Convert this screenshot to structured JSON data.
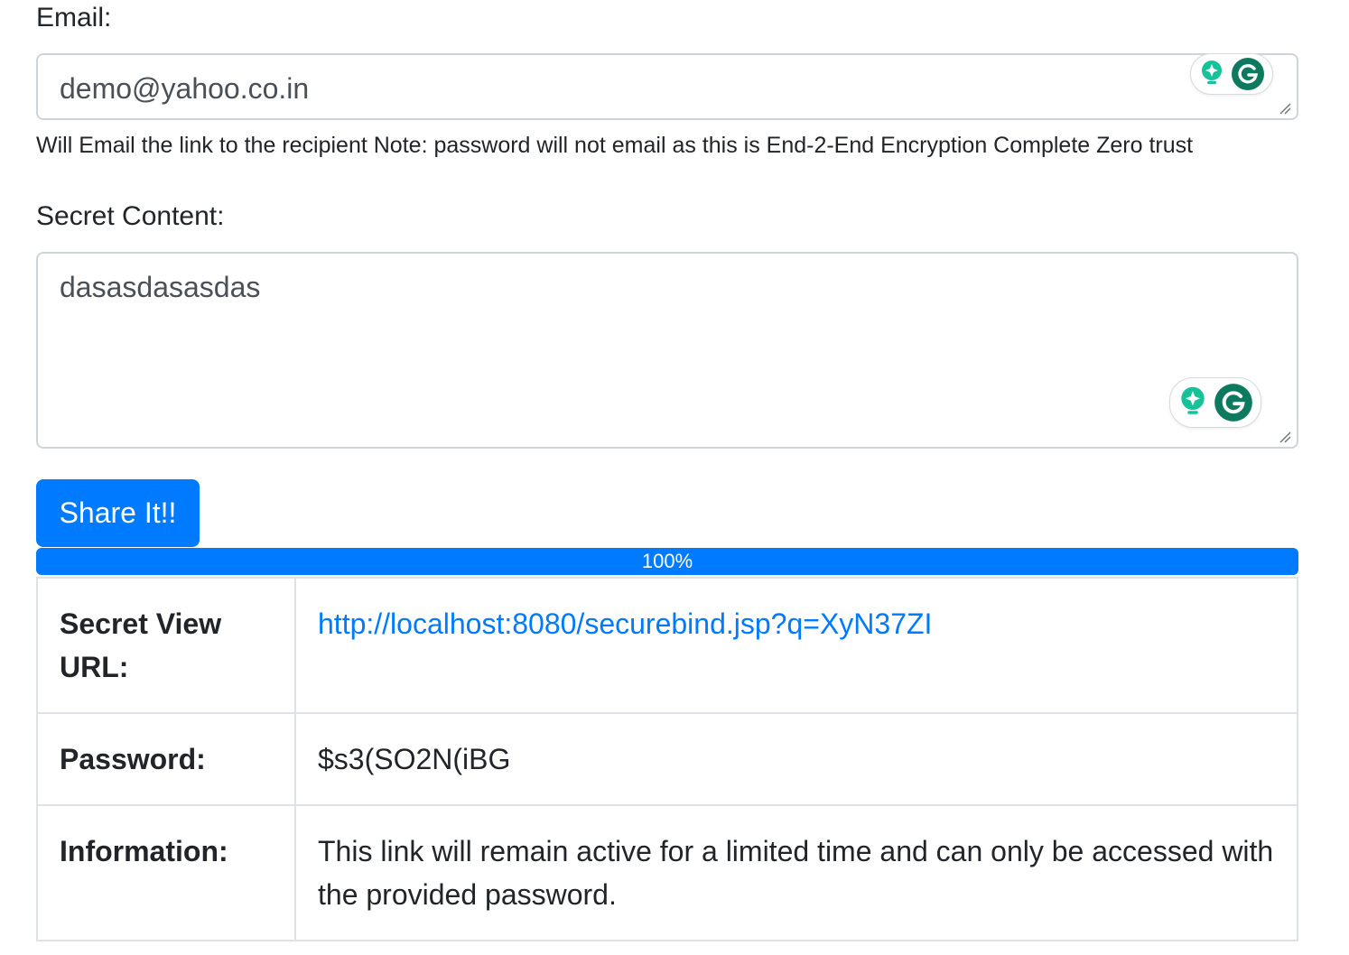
{
  "form": {
    "email_label": "Email:",
    "email_value": "demo@yahoo.co.in",
    "email_help": "Will Email the link to the recipient Note: password will not email as this is End-2-End Encryption Complete Zero trust",
    "secret_label": "Secret Content:",
    "secret_value": "dasasdasasdas",
    "submit_label": "Share It!!"
  },
  "progress": {
    "label": "100%",
    "value_percent": 100,
    "bar_color": "#007bff"
  },
  "result": {
    "rows": [
      {
        "key": "Secret View URL:",
        "value": "http://localhost:8080/securebind.jsp?q=XyN37ZI"
      },
      {
        "key": "Password:",
        "value": "$s3(SO2N(iBG"
      },
      {
        "key": "Information:",
        "value": "This link will remain active for a limited time and can only be accessed with the provided password."
      }
    ]
  },
  "colors": {
    "primary": "#007bff",
    "grammarly_green": "#15c39a",
    "grammarly_dark": "#0d7a5f"
  },
  "icons": {
    "assistant": "bulb-sparkle-icon",
    "grammarly": "grammarly-g-icon",
    "resize": "resize-grip-icon"
  }
}
